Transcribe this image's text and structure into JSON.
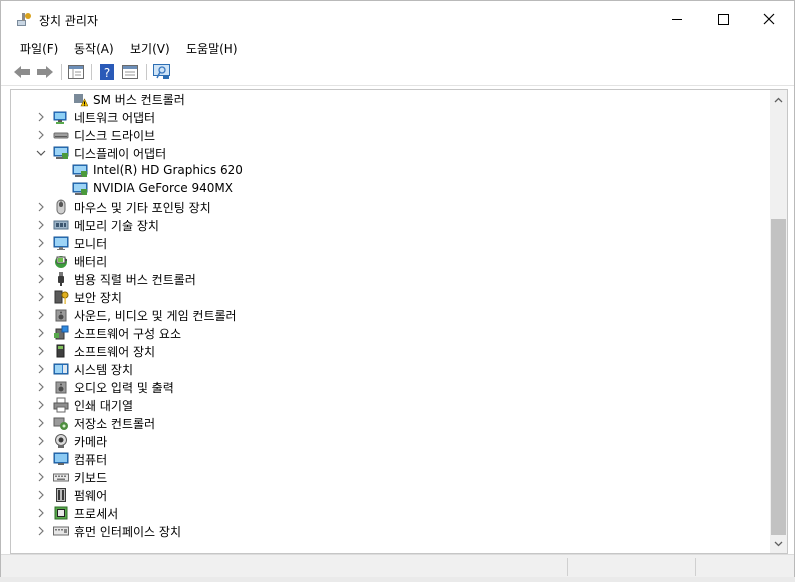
{
  "window": {
    "title": "장치 관리자"
  },
  "menu": [
    {
      "label": "파일(F)"
    },
    {
      "label": "동작(A)"
    },
    {
      "label": "보기(V)"
    },
    {
      "label": "도움말(H)"
    }
  ],
  "tree": [
    {
      "label": "SM 버스 컨트롤러",
      "icon": "warning-device-icon",
      "level": 2,
      "expander": "none"
    },
    {
      "label": "네트워크 어댑터",
      "icon": "network-adapter-icon",
      "level": 1,
      "expander": "collapsed"
    },
    {
      "label": "디스크 드라이브",
      "icon": "disk-drive-icon",
      "level": 1,
      "expander": "collapsed"
    },
    {
      "label": "디스플레이 어댑터",
      "icon": "display-adapter-icon",
      "level": 1,
      "expander": "expanded"
    },
    {
      "label": "Intel(R) HD Graphics 620",
      "icon": "display-adapter-icon",
      "level": 2,
      "expander": "none"
    },
    {
      "label": "NVIDIA GeForce 940MX",
      "icon": "display-adapter-icon",
      "level": 2,
      "expander": "none"
    },
    {
      "label": "마우스 및 기타 포인팅 장치",
      "icon": "mouse-icon",
      "level": 1,
      "expander": "collapsed"
    },
    {
      "label": "메모리 기술 장치",
      "icon": "memory-icon",
      "level": 1,
      "expander": "collapsed"
    },
    {
      "label": "모니터",
      "icon": "monitor-icon",
      "level": 1,
      "expander": "collapsed"
    },
    {
      "label": "배터리",
      "icon": "battery-icon",
      "level": 1,
      "expander": "collapsed"
    },
    {
      "label": "범용 직렬 버스 컨트롤러",
      "icon": "usb-icon",
      "level": 1,
      "expander": "collapsed"
    },
    {
      "label": "보안 장치",
      "icon": "security-key-icon",
      "level": 1,
      "expander": "collapsed"
    },
    {
      "label": "사운드, 비디오 및 게임 컨트롤러",
      "icon": "speaker-icon",
      "level": 1,
      "expander": "collapsed"
    },
    {
      "label": "소프트웨어 구성 요소",
      "icon": "software-component-icon",
      "level": 1,
      "expander": "collapsed"
    },
    {
      "label": "소프트웨어 장치",
      "icon": "software-device-icon",
      "level": 1,
      "expander": "collapsed"
    },
    {
      "label": "시스템 장치",
      "icon": "system-device-icon",
      "level": 1,
      "expander": "collapsed"
    },
    {
      "label": "오디오 입력 및 출력",
      "icon": "speaker-icon",
      "level": 1,
      "expander": "collapsed"
    },
    {
      "label": "인쇄 대기열",
      "icon": "printer-icon",
      "level": 1,
      "expander": "collapsed"
    },
    {
      "label": "저장소 컨트롤러",
      "icon": "storage-controller-icon",
      "level": 1,
      "expander": "collapsed"
    },
    {
      "label": "카메라",
      "icon": "camera-icon",
      "level": 1,
      "expander": "collapsed"
    },
    {
      "label": "컴퓨터",
      "icon": "computer-icon",
      "level": 1,
      "expander": "collapsed"
    },
    {
      "label": "키보드",
      "icon": "keyboard-icon",
      "level": 1,
      "expander": "collapsed"
    },
    {
      "label": "펌웨어",
      "icon": "firmware-icon",
      "level": 1,
      "expander": "collapsed"
    },
    {
      "label": "프로세서",
      "icon": "processor-icon",
      "level": 1,
      "expander": "collapsed"
    },
    {
      "label": "휴먼 인터페이스 장치",
      "icon": "hid-icon",
      "level": 1,
      "expander": "collapsed"
    }
  ],
  "toolbar": [
    {
      "icon": "back-arrow-icon"
    },
    {
      "icon": "forward-arrow-icon"
    },
    {
      "icon": "show-hide-console-tree-icon"
    },
    {
      "icon": "help-icon"
    },
    {
      "icon": "properties-icon"
    },
    {
      "icon": "scan-hardware-icon"
    }
  ],
  "colors": {
    "accent": "#1f6fc4",
    "scrollbar_thumb": "#c2c2c2"
  }
}
